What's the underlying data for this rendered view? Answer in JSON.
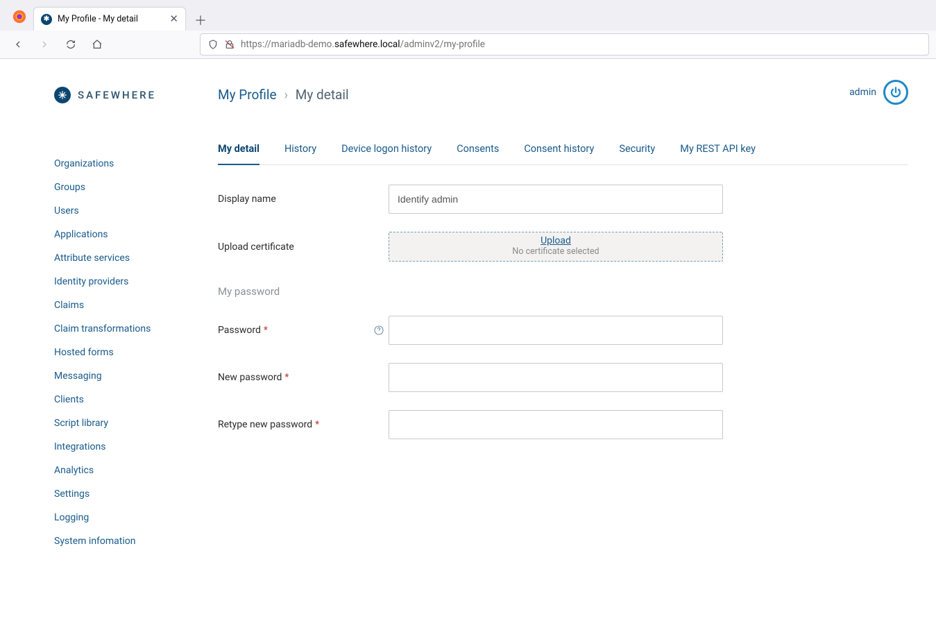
{
  "browser": {
    "tab_title": "My Profile - My detail",
    "url_prefix": "https://mariadb-demo.",
    "url_host": "safewhere.local",
    "url_path": "/adminv2/my-profile"
  },
  "logo": {
    "text": "SAFEWHERE"
  },
  "sidebar": {
    "items": [
      {
        "label": "Organizations"
      },
      {
        "label": "Groups"
      },
      {
        "label": "Users"
      },
      {
        "label": "Applications"
      },
      {
        "label": "Attribute services"
      },
      {
        "label": "Identity providers"
      },
      {
        "label": "Claims"
      },
      {
        "label": "Claim transformations"
      },
      {
        "label": "Hosted forms"
      },
      {
        "label": "Messaging"
      },
      {
        "label": "Clients"
      },
      {
        "label": "Script library"
      },
      {
        "label": "Integrations"
      },
      {
        "label": "Analytics"
      },
      {
        "label": "Settings"
      },
      {
        "label": "Logging"
      },
      {
        "label": "System infomation"
      }
    ]
  },
  "header": {
    "breadcrumb_root": "My Profile",
    "breadcrumb_current": "My detail",
    "user_name": "admin"
  },
  "tabs": [
    {
      "label": "My detail",
      "active": true
    },
    {
      "label": "History"
    },
    {
      "label": "Device logon history"
    },
    {
      "label": "Consents"
    },
    {
      "label": "Consent history"
    },
    {
      "label": "Security"
    },
    {
      "label": "My REST API key"
    }
  ],
  "form": {
    "display_name_label": "Display name",
    "display_name_value": "Identify admin",
    "upload_cert_label": "Upload certificate",
    "upload_link": "Upload",
    "upload_sub": "No certificate selected",
    "section_password": "My password",
    "password_label": "Password",
    "new_password_label": "New password",
    "retype_password_label": "Retype new password",
    "required_mark": "*"
  }
}
